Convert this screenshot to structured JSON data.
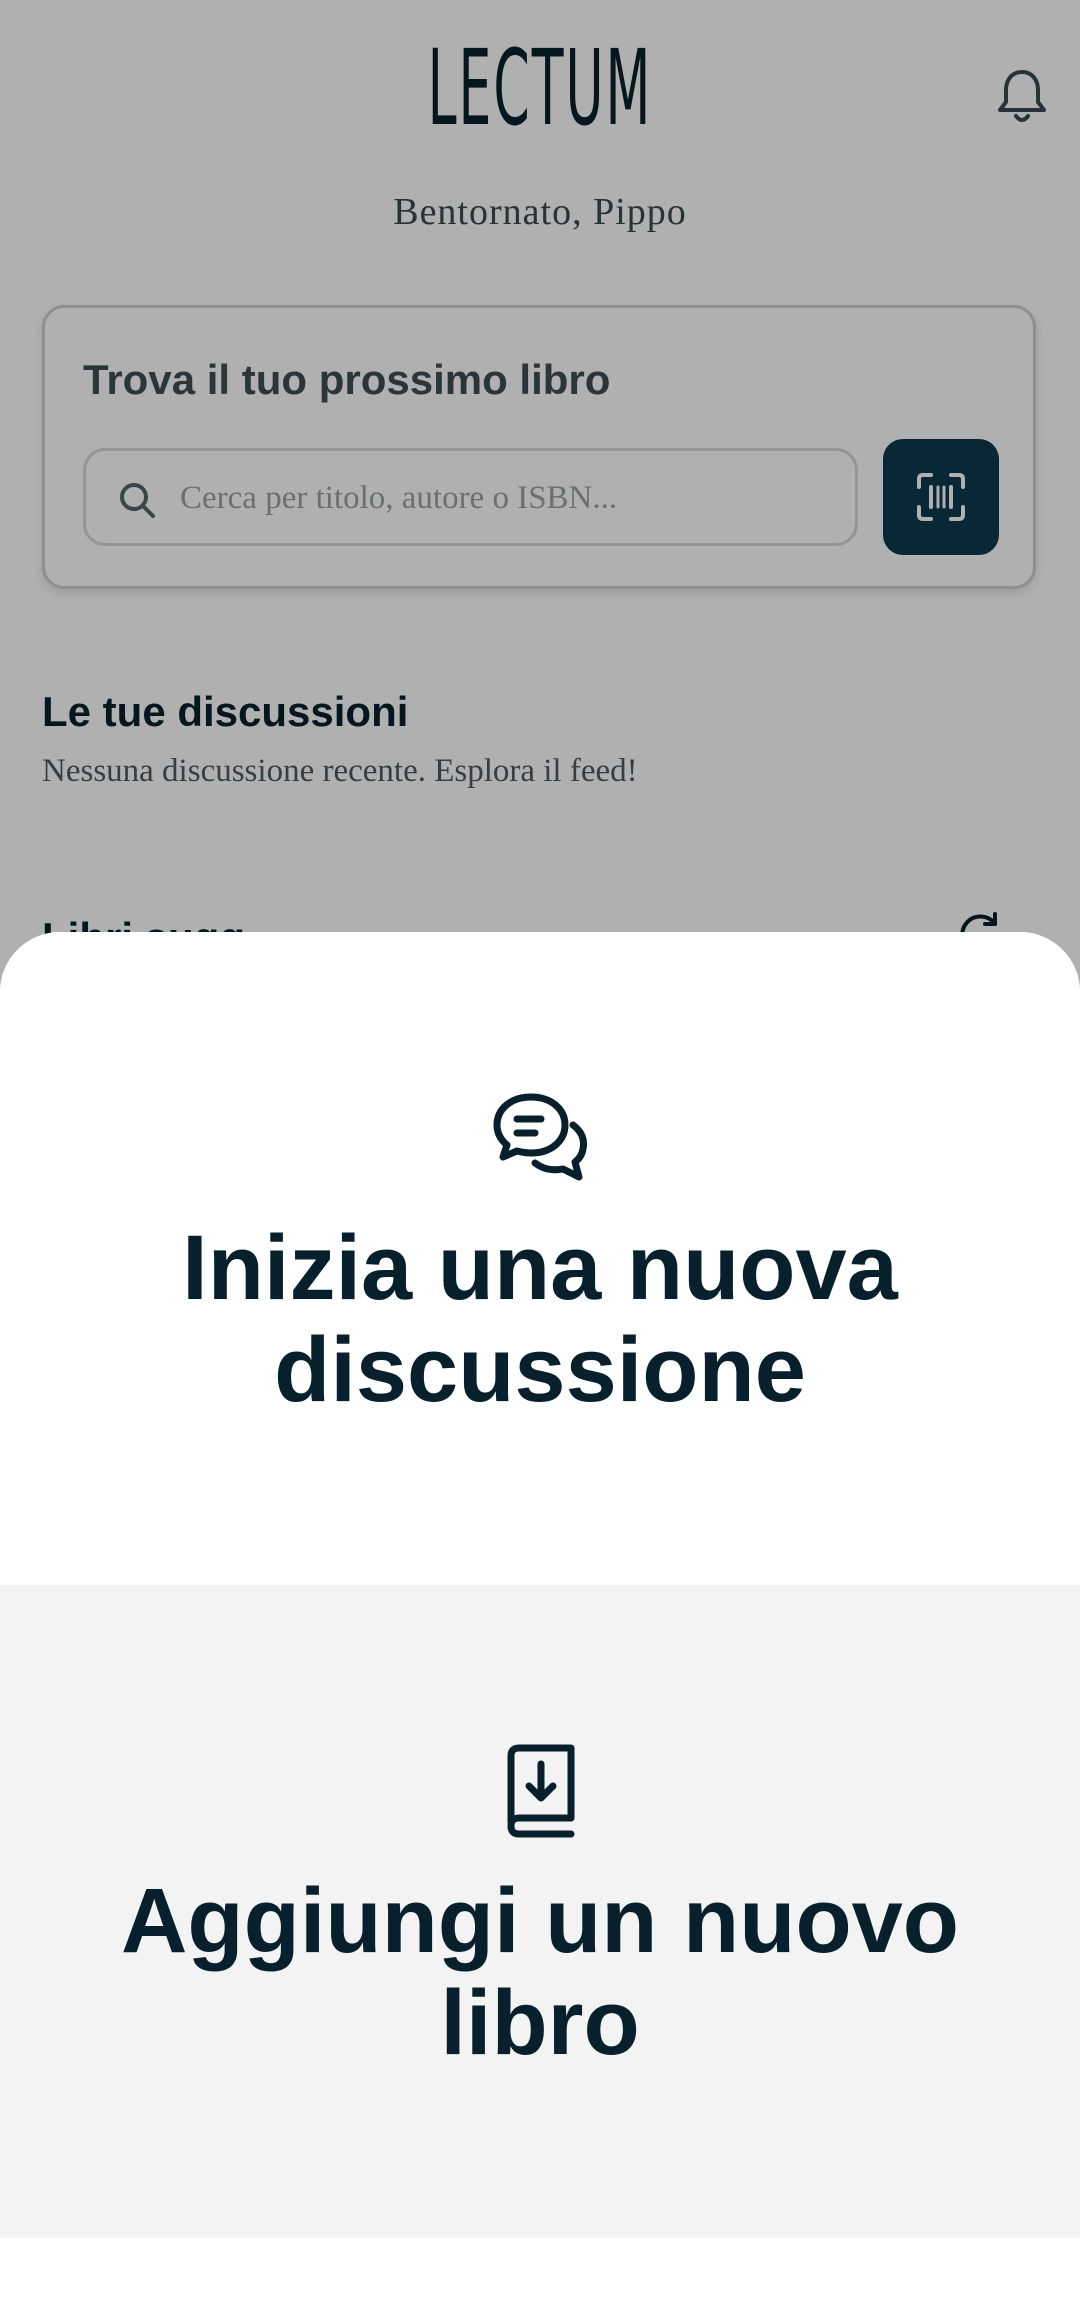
{
  "app": {
    "logo": "LECTUM",
    "welcome": "Bentornato, Pippo"
  },
  "search_card": {
    "title": "Trova il tuo prossimo libro",
    "placeholder": "Cerca per titolo, autore o ISBN..."
  },
  "discussions": {
    "title": "Le tue discussioni",
    "empty_message": "Nessuna discussione recente. Esplora il feed!"
  },
  "next_section": {
    "title_partial": "Libri sugg"
  },
  "sheet": {
    "options": [
      {
        "label": "Inizia una nuova discussione",
        "icon": "chat-bubbles-icon"
      },
      {
        "label": "Aggiungi un nuovo libro",
        "icon": "book-download-icon"
      }
    ]
  },
  "colors": {
    "primary": "#0d3a4e",
    "text_dark": "#07202c",
    "overlay": "rgba(0,0,0,0.31)",
    "sheet_alt": "#f3f3f3"
  }
}
